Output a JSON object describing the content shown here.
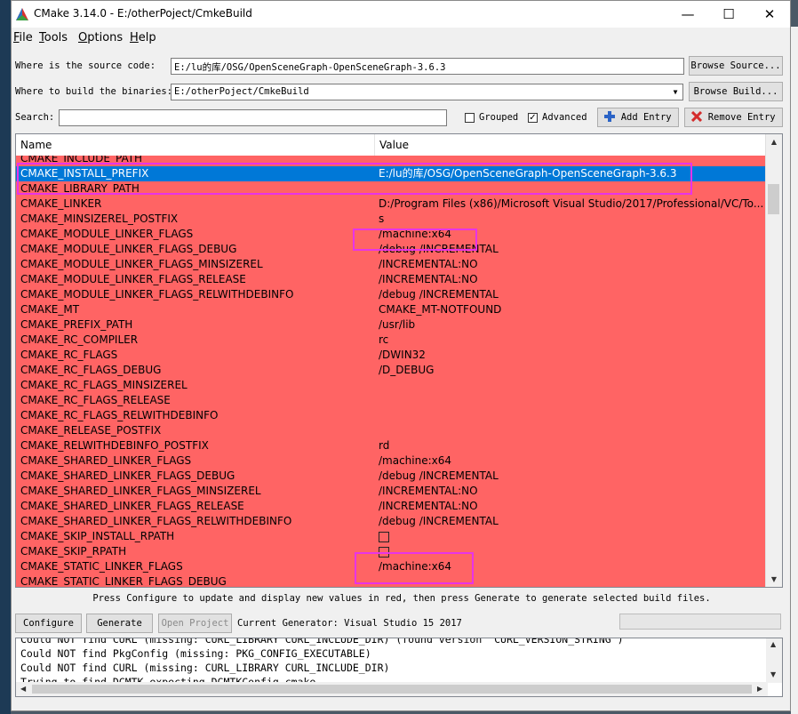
{
  "window": {
    "title": "CMake 3.14.0 - E:/otherPoject/CmkeBuild",
    "controls": {
      "minimize": "—",
      "maximize": "☐",
      "close": "✕"
    }
  },
  "menu": [
    {
      "underline": "F",
      "rest": "ile"
    },
    {
      "underline": "T",
      "rest": "ools"
    },
    {
      "underline": "O",
      "rest": "ptions"
    },
    {
      "underline": "H",
      "rest": "elp"
    }
  ],
  "source": {
    "label": "Where is the source code:",
    "value": "E:/lu的库/OSG/OpenSceneGraph-OpenSceneGraph-3.6.3",
    "browse_label": "Browse Source..."
  },
  "build": {
    "label": "Where to build the binaries:",
    "value": "E:/otherPoject/CmkeBuild",
    "browse_label": "Browse Build..."
  },
  "search": {
    "label": "Search:",
    "value": "",
    "grouped_label": "Grouped",
    "grouped_checked": false,
    "advanced_label": "Advanced",
    "advanced_checked": true,
    "add_entry_label": "Add Entry",
    "remove_entry_label": "Remove Entry"
  },
  "table": {
    "columns": [
      "Name",
      "Value"
    ],
    "rows": [
      {
        "name": "CMAKE_INCLUDE_PATH",
        "value": ""
      },
      {
        "name": "CMAKE_INSTALL_PREFIX",
        "value": "E:/lu的库/OSG/OpenSceneGraph-OpenSceneGraph-3.6.3",
        "selected": true
      },
      {
        "name": "CMAKE_LIBRARY_PATH",
        "value": ""
      },
      {
        "name": "CMAKE_LINKER",
        "value": "D:/Program Files (x86)/Microsoft Visual Studio/2017/Professional/VC/To..."
      },
      {
        "name": "CMAKE_MINSIZEREL_POSTFIX",
        "value": "s"
      },
      {
        "name": "CMAKE_MODULE_LINKER_FLAGS",
        "value": "/machine:x64"
      },
      {
        "name": "CMAKE_MODULE_LINKER_FLAGS_DEBUG",
        "value": "/debug /INCREMENTAL"
      },
      {
        "name": "CMAKE_MODULE_LINKER_FLAGS_MINSIZEREL",
        "value": "/INCREMENTAL:NO"
      },
      {
        "name": "CMAKE_MODULE_LINKER_FLAGS_RELEASE",
        "value": "/INCREMENTAL:NO"
      },
      {
        "name": "CMAKE_MODULE_LINKER_FLAGS_RELWITHDEBINFO",
        "value": "/debug /INCREMENTAL"
      },
      {
        "name": "CMAKE_MT",
        "value": "CMAKE_MT-NOTFOUND"
      },
      {
        "name": "CMAKE_PREFIX_PATH",
        "value": "/usr/lib"
      },
      {
        "name": "CMAKE_RC_COMPILER",
        "value": "rc"
      },
      {
        "name": "CMAKE_RC_FLAGS",
        "value": "/DWIN32"
      },
      {
        "name": "CMAKE_RC_FLAGS_DEBUG",
        "value": "/D_DEBUG"
      },
      {
        "name": "CMAKE_RC_FLAGS_MINSIZEREL",
        "value": ""
      },
      {
        "name": "CMAKE_RC_FLAGS_RELEASE",
        "value": ""
      },
      {
        "name": "CMAKE_RC_FLAGS_RELWITHDEBINFO",
        "value": ""
      },
      {
        "name": "CMAKE_RELEASE_POSTFIX",
        "value": ""
      },
      {
        "name": "CMAKE_RELWITHDEBINFO_POSTFIX",
        "value": "rd"
      },
      {
        "name": "CMAKE_SHARED_LINKER_FLAGS",
        "value": "/machine:x64"
      },
      {
        "name": "CMAKE_SHARED_LINKER_FLAGS_DEBUG",
        "value": "/debug /INCREMENTAL"
      },
      {
        "name": "CMAKE_SHARED_LINKER_FLAGS_MINSIZEREL",
        "value": "/INCREMENTAL:NO"
      },
      {
        "name": "CMAKE_SHARED_LINKER_FLAGS_RELEASE",
        "value": "/INCREMENTAL:NO"
      },
      {
        "name": "CMAKE_SHARED_LINKER_FLAGS_RELWITHDEBINFO",
        "value": "/debug /INCREMENTAL"
      },
      {
        "name": "CMAKE_SKIP_INSTALL_RPATH",
        "checkbox": true
      },
      {
        "name": "CMAKE_SKIP_RPATH",
        "checkbox": true
      },
      {
        "name": "CMAKE_STATIC_LINKER_FLAGS",
        "value": "/machine:x64"
      },
      {
        "name": "CMAKE_STATIC_LINKER_FLAGS_DEBUG",
        "value": ""
      }
    ]
  },
  "info_text": "Press Configure to update and display new values in red, then press Generate to generate selected build files.",
  "actions": {
    "configure_label": "Configure",
    "generate_label": "Generate",
    "open_project_label": "Open Project",
    "generator_text": "Current Generator: Visual Studio 15 2017"
  },
  "output": {
    "lines": [
      "Could NOT find CURL (missing: CURL_LIBRARY CURL_INCLUDE_DIR) (found version \"CURL_VERSION_STRING\")",
      "Could NOT find PkgConfig (missing: PKG_CONFIG_EXECUTABLE)",
      "Could NOT find CURL (missing: CURL_LIBRARY CURL_INCLUDE_DIR)",
      "Trying to find DCMTK expecting DCMTKConfig.cmake"
    ]
  },
  "colors": {
    "changed_row_bg": "#ff6464",
    "selection_bg": "#0078d7",
    "annotation": "#e833e8"
  }
}
